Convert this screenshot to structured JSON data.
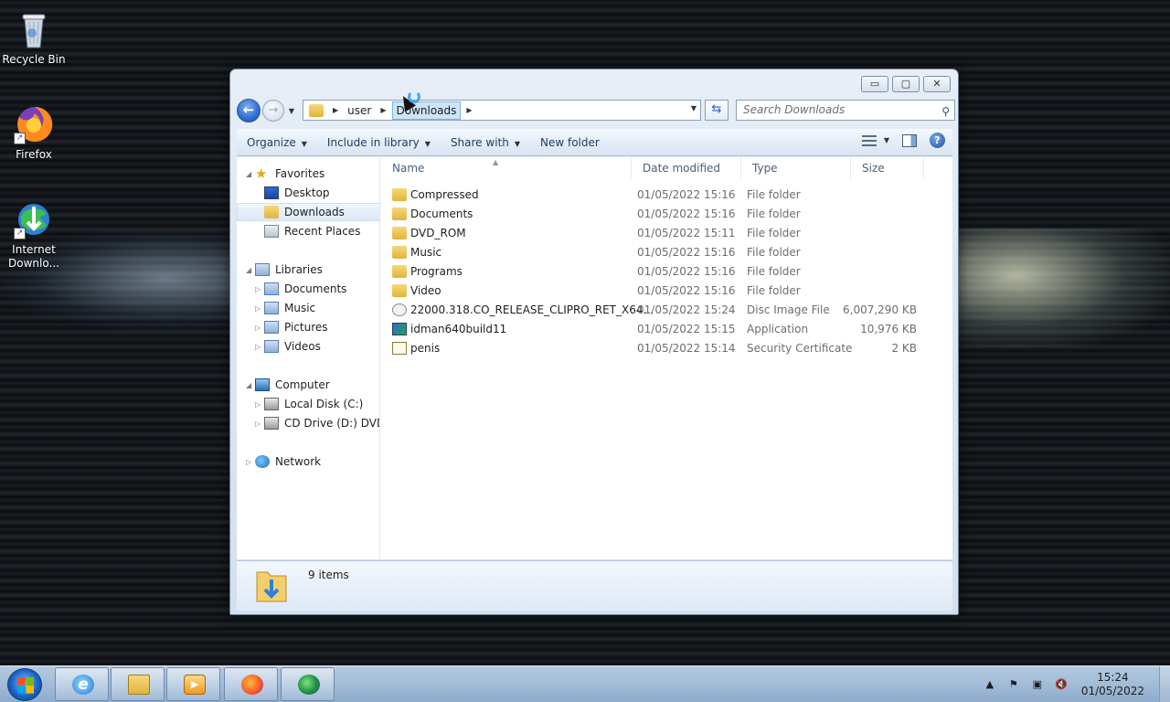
{
  "desktop": {
    "icons": [
      {
        "label": "Recycle Bin",
        "icon": "recycle-bin-icon"
      },
      {
        "label": "Firefox",
        "icon": "firefox-icon"
      },
      {
        "label_line1": "Internet",
        "label_line2": "Downlo...",
        "icon": "idm-icon"
      }
    ]
  },
  "window": {
    "minimize": "▭",
    "maximize": "▢",
    "close": "✕",
    "address": {
      "crumbs": [
        "user",
        "Downloads"
      ]
    },
    "search_placeholder": "Search Downloads",
    "toolbar": {
      "organize": "Organize",
      "include_in_library": "Include in library",
      "share_with": "Share with",
      "new_folder": "New folder"
    },
    "nav": {
      "favorites": "Favorites",
      "desktop": "Desktop",
      "downloads": "Downloads",
      "recent_places": "Recent Places",
      "libraries": "Libraries",
      "documents": "Documents",
      "music": "Music",
      "pictures": "Pictures",
      "videos": "Videos",
      "computer": "Computer",
      "local_disk": "Local Disk (C:)",
      "cd_drive": "CD Drive (D:) DVD_R",
      "network": "Network"
    },
    "columns": {
      "name": "Name",
      "date_modified": "Date modified",
      "type": "Type",
      "size": "Size"
    },
    "files": [
      {
        "name": "Compressed",
        "date": "01/05/2022 15:16",
        "type": "File folder",
        "size": "",
        "icon": "folder-icon"
      },
      {
        "name": "Documents",
        "date": "01/05/2022 15:16",
        "type": "File folder",
        "size": "",
        "icon": "folder-icon"
      },
      {
        "name": "DVD_ROM",
        "date": "01/05/2022 15:11",
        "type": "File folder",
        "size": "",
        "icon": "folder-icon"
      },
      {
        "name": "Music",
        "date": "01/05/2022 15:16",
        "type": "File folder",
        "size": "",
        "icon": "folder-icon"
      },
      {
        "name": "Programs",
        "date": "01/05/2022 15:16",
        "type": "File folder",
        "size": "",
        "icon": "folder-icon"
      },
      {
        "name": "Video",
        "date": "01/05/2022 15:16",
        "type": "File folder",
        "size": "",
        "icon": "folder-icon"
      },
      {
        "name": "22000.318.CO_RELEASE_CLIPRO_RET_X64...",
        "date": "01/05/2022 15:24",
        "type": "Disc Image File",
        "size": "6,007,290 KB",
        "icon": "disc-image-icon"
      },
      {
        "name": "idman640build11",
        "date": "01/05/2022 15:15",
        "type": "Application",
        "size": "10,976 KB",
        "icon": "application-icon"
      },
      {
        "name": "penis",
        "date": "01/05/2022 15:14",
        "type": "Security Certificate",
        "size": "2 KB",
        "icon": "certificate-icon"
      }
    ],
    "status": {
      "item_count": "9 items"
    }
  },
  "taskbar": {
    "clock_time": "15:24",
    "clock_date": "01/05/2022",
    "ie_glyph": "e"
  }
}
